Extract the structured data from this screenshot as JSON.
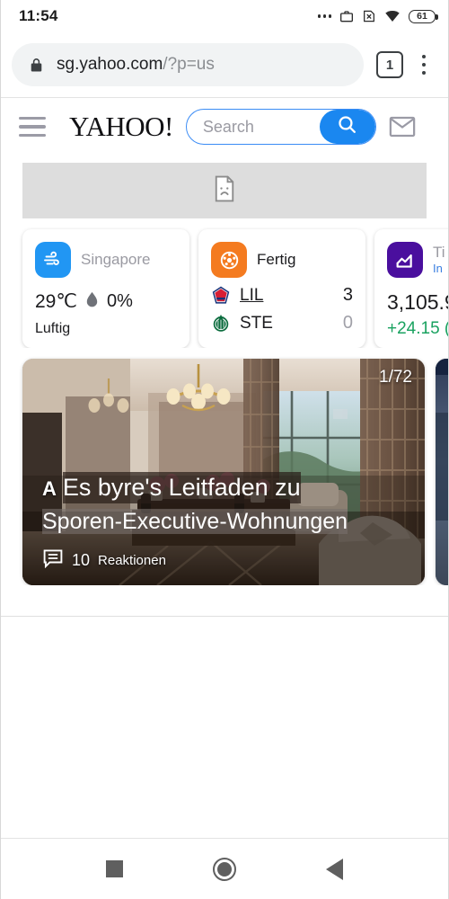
{
  "status_bar": {
    "clock": "11:54",
    "battery_level": "61",
    "icons": [
      "more-dots-icon",
      "work-profile-icon",
      "no-sim-icon",
      "wifi-icon",
      "battery-icon"
    ]
  },
  "browser": {
    "url_host": "sg.yahoo.com",
    "url_path": "/?p=us",
    "tab_count": "1",
    "lock_icon": "lock-icon",
    "menu_icon": "kebab-menu-icon"
  },
  "site_header": {
    "logo": "YAHOO!",
    "search_value": "",
    "search_placeholder": "Search",
    "menu_icon": "hamburger-icon",
    "search_icon": "search-icon",
    "mail_icon": "mail-icon"
  },
  "broken_image": {
    "icon": "broken-image-icon",
    "bg_color": "#dddddd"
  },
  "cards": [
    {
      "type": "weather",
      "icon": "wind-icon",
      "icon_color": "#2196f3",
      "location": "Singapore",
      "temperature": "29℃",
      "humidity_icon": "water-drop-icon",
      "humidity": "0%",
      "condition": "Luftig"
    },
    {
      "type": "sports",
      "icon": "soccer-ball-icon",
      "icon_color": "#f47b20",
      "status": "Fertig",
      "teams": [
        {
          "logo": "lille-crest-icon",
          "abbr": "LIL",
          "score": "3",
          "winner": true
        },
        {
          "logo": "saint-etienne-crest-icon",
          "abbr": "STE",
          "score": "0",
          "winner": false
        }
      ]
    },
    {
      "type": "finance",
      "icon": "line-chart-icon",
      "icon_color": "#4a0f9e",
      "title": "Ti",
      "subtitle": "In",
      "value": "3,105.9",
      "change": "+24.15 (",
      "change_color": "#1aa260"
    }
  ],
  "news_cards": [
    {
      "image_counter": "1/72",
      "brandmark": "A",
      "headline_line1": "Es byre's Leitfaden zu",
      "headline_line2": "Sporen-Executive-Wohnungen",
      "reactions_icon": "comment-icon",
      "reactions_count": "10",
      "reactions_label": "Reaktionen"
    },
    {
      "image_counter": "",
      "brandmark": "",
      "headline_line1": "",
      "headline_line2": "",
      "reactions_icon": "comment-icon",
      "reactions_count": "",
      "reactions_label": ""
    }
  ],
  "nav_bar": {
    "recents": "recents-square-icon",
    "home": "home-circle-icon",
    "back": "back-triangle-icon"
  }
}
